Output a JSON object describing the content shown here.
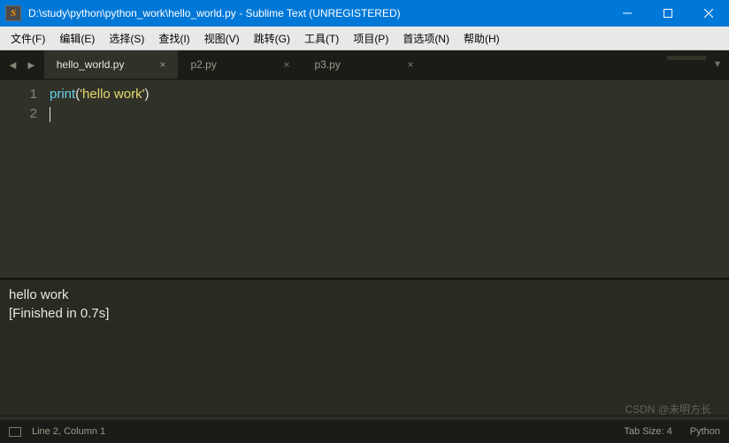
{
  "titlebar": {
    "icon_letter": "S",
    "title": "D:\\study\\python\\python_work\\hello_world.py - Sublime Text (UNREGISTERED)"
  },
  "menubar": {
    "items": [
      "文件(F)",
      "编辑(E)",
      "选择(S)",
      "查找(I)",
      "视图(V)",
      "跳转(G)",
      "工具(T)",
      "项目(P)",
      "首选项(N)",
      "帮助(H)"
    ]
  },
  "tabs": {
    "arrow_left": "◄",
    "arrow_right": "►",
    "dropdown": "▼",
    "items": [
      {
        "label": "hello_world.py",
        "active": true
      },
      {
        "label": "p2.py",
        "active": false
      },
      {
        "label": "p3.py",
        "active": false
      }
    ],
    "close_glyph": "×"
  },
  "editor": {
    "lines": [
      {
        "num": "1",
        "fn": "print",
        "paren_open": "(",
        "str": "'hello work'",
        "paren_close": ")"
      },
      {
        "num": "2"
      }
    ]
  },
  "output": {
    "line1": "hello work",
    "line2": "[Finished in 0.7s]"
  },
  "statusbar": {
    "position": "Line 2, Column 1",
    "tab_size": "Tab Size: 4",
    "syntax": "Python"
  },
  "watermark": "CSDN @未明方长"
}
